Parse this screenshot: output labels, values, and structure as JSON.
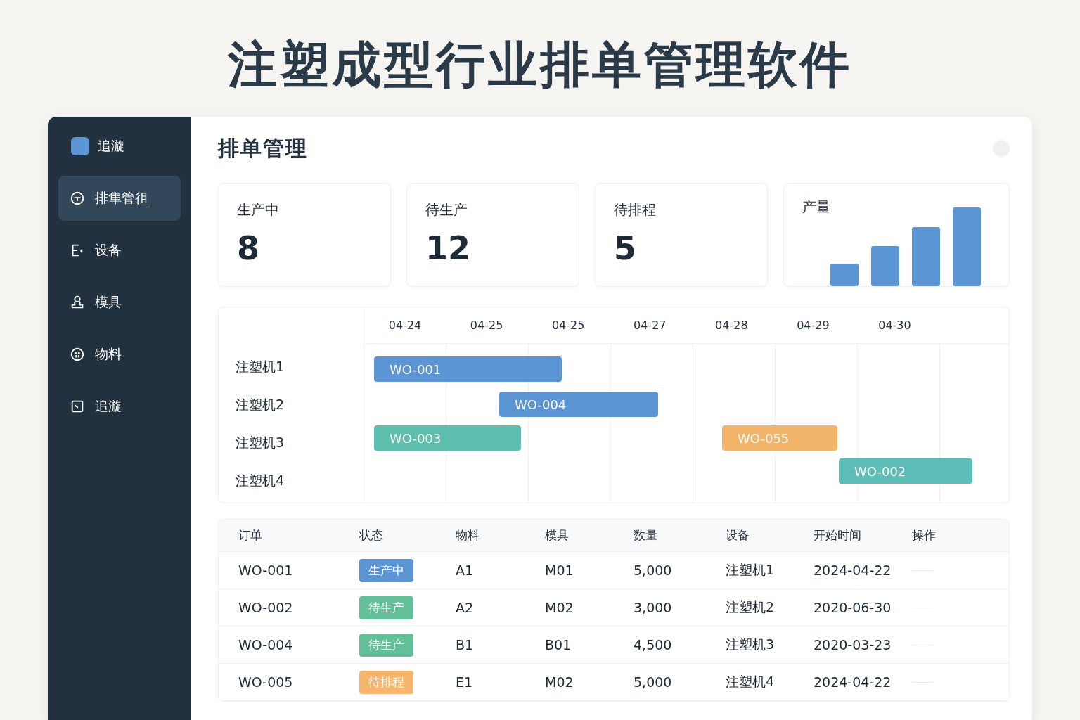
{
  "page_title": "注塑成型行业排单管理软件",
  "sidebar": {
    "logo": "追漩",
    "items": [
      {
        "label": "排隼管徂",
        "selected": true
      },
      {
        "label": "设备",
        "selected": false
      },
      {
        "label": "模具",
        "selected": false
      },
      {
        "label": "物料",
        "selected": false
      },
      {
        "label": "追漩",
        "selected": false
      }
    ]
  },
  "header": {
    "title": "排单管理"
  },
  "stats": [
    {
      "label": "生产中",
      "value": "8"
    },
    {
      "label": "待生产",
      "value": "12"
    },
    {
      "label": "待排程",
      "value": "5"
    }
  ],
  "output_card": {
    "label": "产量"
  },
  "gantt": {
    "dates": [
      "04-24",
      "04-25",
      "04-25",
      "04-27",
      "04-28",
      "04-29",
      "04-30"
    ],
    "machines": [
      {
        "name": "注塑机1",
        "tasks": [
          {
            "label": "WO-001",
            "color": "#5b95d3"
          }
        ]
      },
      {
        "name": "注塑机2",
        "tasks": [
          {
            "label": "WO-004",
            "color": "#5b95d3"
          }
        ]
      },
      {
        "name": "注塑机3",
        "tasks": [
          {
            "label": "WO-003",
            "color": "#5fbfae"
          },
          {
            "label": "WO-055",
            "color": "#f2b468"
          }
        ]
      },
      {
        "name": "注塑机4",
        "tasks": [
          {
            "label": "WO-002",
            "color": "#5dbdb8"
          }
        ]
      }
    ]
  },
  "table": {
    "columns": [
      "订单",
      "状态",
      "物料",
      "模具",
      "数量",
      "设备",
      "开始时间",
      "操作"
    ],
    "rows": [
      {
        "order": "WO-001",
        "status": "生产中",
        "color": "#5b95d3",
        "material": "A1",
        "mold": "M01",
        "qty": "5,000",
        "machine": "注塑机1",
        "start": "2024-04-22"
      },
      {
        "order": "WO-002",
        "status": "待生产",
        "color": "#63bf97",
        "material": "A2",
        "mold": "M02",
        "qty": "3,000",
        "machine": "注塑机2",
        "start": "2020-06-30"
      },
      {
        "order": "WO-004",
        "status": "待生产",
        "color": "#63bf97",
        "material": "B1",
        "mold": "B01",
        "qty": "4,500",
        "machine": "注塑机3",
        "start": "2020-03-23"
      },
      {
        "order": "WO-005",
        "status": "待排程",
        "color": "#f5b56c",
        "material": "E1",
        "mold": "M02",
        "qty": "5,000",
        "machine": "注塑机4",
        "start": "2024-04-22"
      }
    ]
  }
}
